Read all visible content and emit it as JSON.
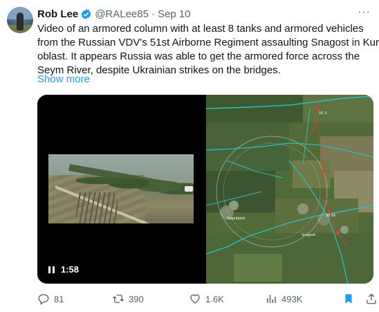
{
  "author": {
    "name": "Rob Lee",
    "handle": "@RALee85",
    "separator": "·",
    "date": "Sep 10",
    "verified_color": "#1d9bf0"
  },
  "tweet": {
    "lines": [
      "Video of an armored column with at least 8 tanks and armored vehicles",
      "from the Russian VDV's 51st Airborne Regiment assaulting Snagost in Kursk",
      "oblast. It appears Russia was able to get the armored force across the",
      "Seym River, despite Ukrainian strikes on the bridges."
    ],
    "show_more": "Show more"
  },
  "media": {
    "video_time": "1:58",
    "video_state": "playing",
    "map_labels": [
      "Sagadpost",
      "Snagost",
      "38 95",
      "50 3"
    ]
  },
  "actions": {
    "replies": "81",
    "reposts": "390",
    "likes": "1.6K",
    "views": "493K",
    "bookmark_color": "#1d9bf0"
  },
  "icons": [
    "more-icon",
    "verified-icon",
    "reply-icon",
    "retweet-icon",
    "like-icon",
    "views-icon",
    "bookmark-icon",
    "share-icon",
    "pause-icon"
  ]
}
